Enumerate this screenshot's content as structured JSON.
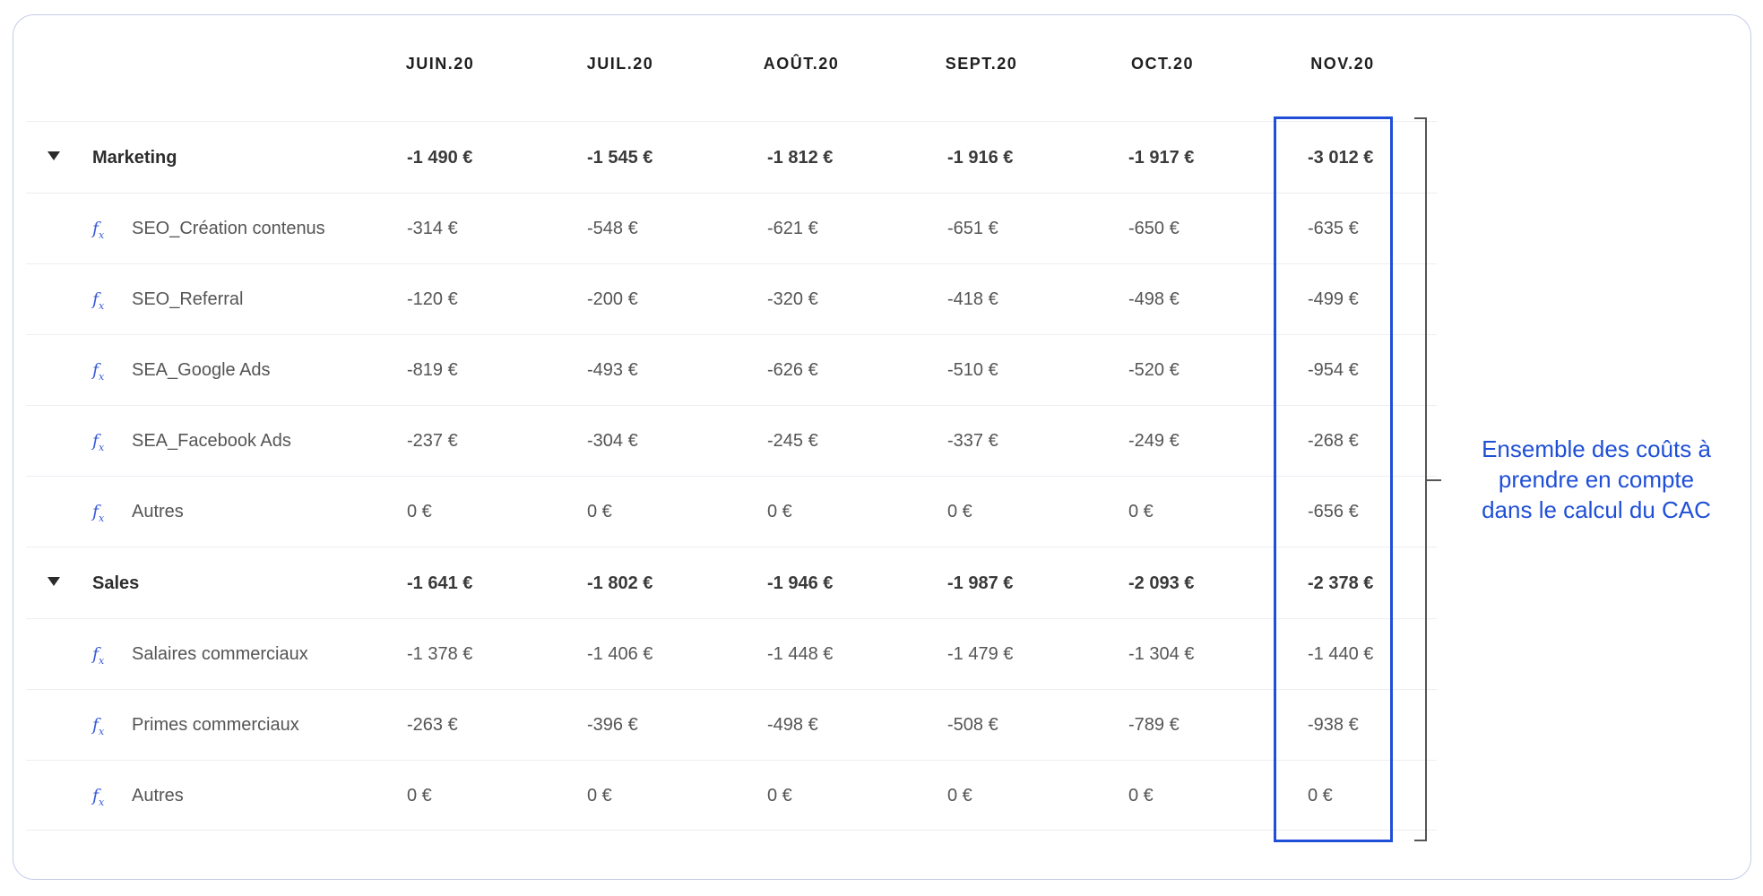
{
  "columns": [
    "JUIN.20",
    "JUIL.20",
    "AOÛT.20",
    "SEPT.20",
    "OCT.20",
    "NOV.20"
  ],
  "fx_icon": "function-icon",
  "rows": [
    {
      "type": "group",
      "label": "Marketing",
      "values": [
        "-1 490 €",
        "-1 545 €",
        "-1 812 €",
        "-1 916 €",
        "-1 917 €",
        "-3 012 €"
      ]
    },
    {
      "type": "item",
      "label": "SEO_Création contenus",
      "values": [
        "-314 €",
        "-548 €",
        "-621 €",
        "-651 €",
        "-650 €",
        "-635 €"
      ]
    },
    {
      "type": "item",
      "label": "SEO_Referral",
      "values": [
        "-120 €",
        "-200 €",
        "-320 €",
        "-418 €",
        "-498 €",
        "-499 €"
      ]
    },
    {
      "type": "item",
      "label": "SEA_Google Ads",
      "values": [
        "-819 €",
        "-493 €",
        "-626 €",
        "-510 €",
        "-520 €",
        "-954 €"
      ]
    },
    {
      "type": "item",
      "label": "SEA_Facebook Ads",
      "values": [
        "-237 €",
        "-304 €",
        "-245 €",
        "-337 €",
        "-249 €",
        "-268 €"
      ]
    },
    {
      "type": "item",
      "label": "Autres",
      "values": [
        "0 €",
        "0 €",
        "0 €",
        "0 €",
        "0 €",
        "-656 €"
      ]
    },
    {
      "type": "group",
      "label": "Sales",
      "values": [
        "-1 641 €",
        "-1 802 €",
        "-1 946 €",
        "-1 987 €",
        "-2 093 €",
        "-2 378 €"
      ]
    },
    {
      "type": "item",
      "label": "Salaires commerciaux",
      "values": [
        "-1 378 €",
        "-1 406 €",
        "-1 448 €",
        "-1 479 €",
        "-1 304 €",
        "-1 440 €"
      ]
    },
    {
      "type": "item",
      "label": "Primes commerciaux",
      "values": [
        "-263 €",
        "-396 €",
        "-498 €",
        "-508 €",
        "-789 €",
        "-938 €"
      ]
    },
    {
      "type": "item",
      "label": "Autres",
      "values": [
        "0 €",
        "0 €",
        "0 €",
        "0 €",
        "0 €",
        "0 €"
      ]
    }
  ],
  "annotation": {
    "lines": [
      "Ensemble des coûts à",
      "prendre en compte",
      "dans le calcul du CAC"
    ],
    "color": "#1f4fd6"
  }
}
